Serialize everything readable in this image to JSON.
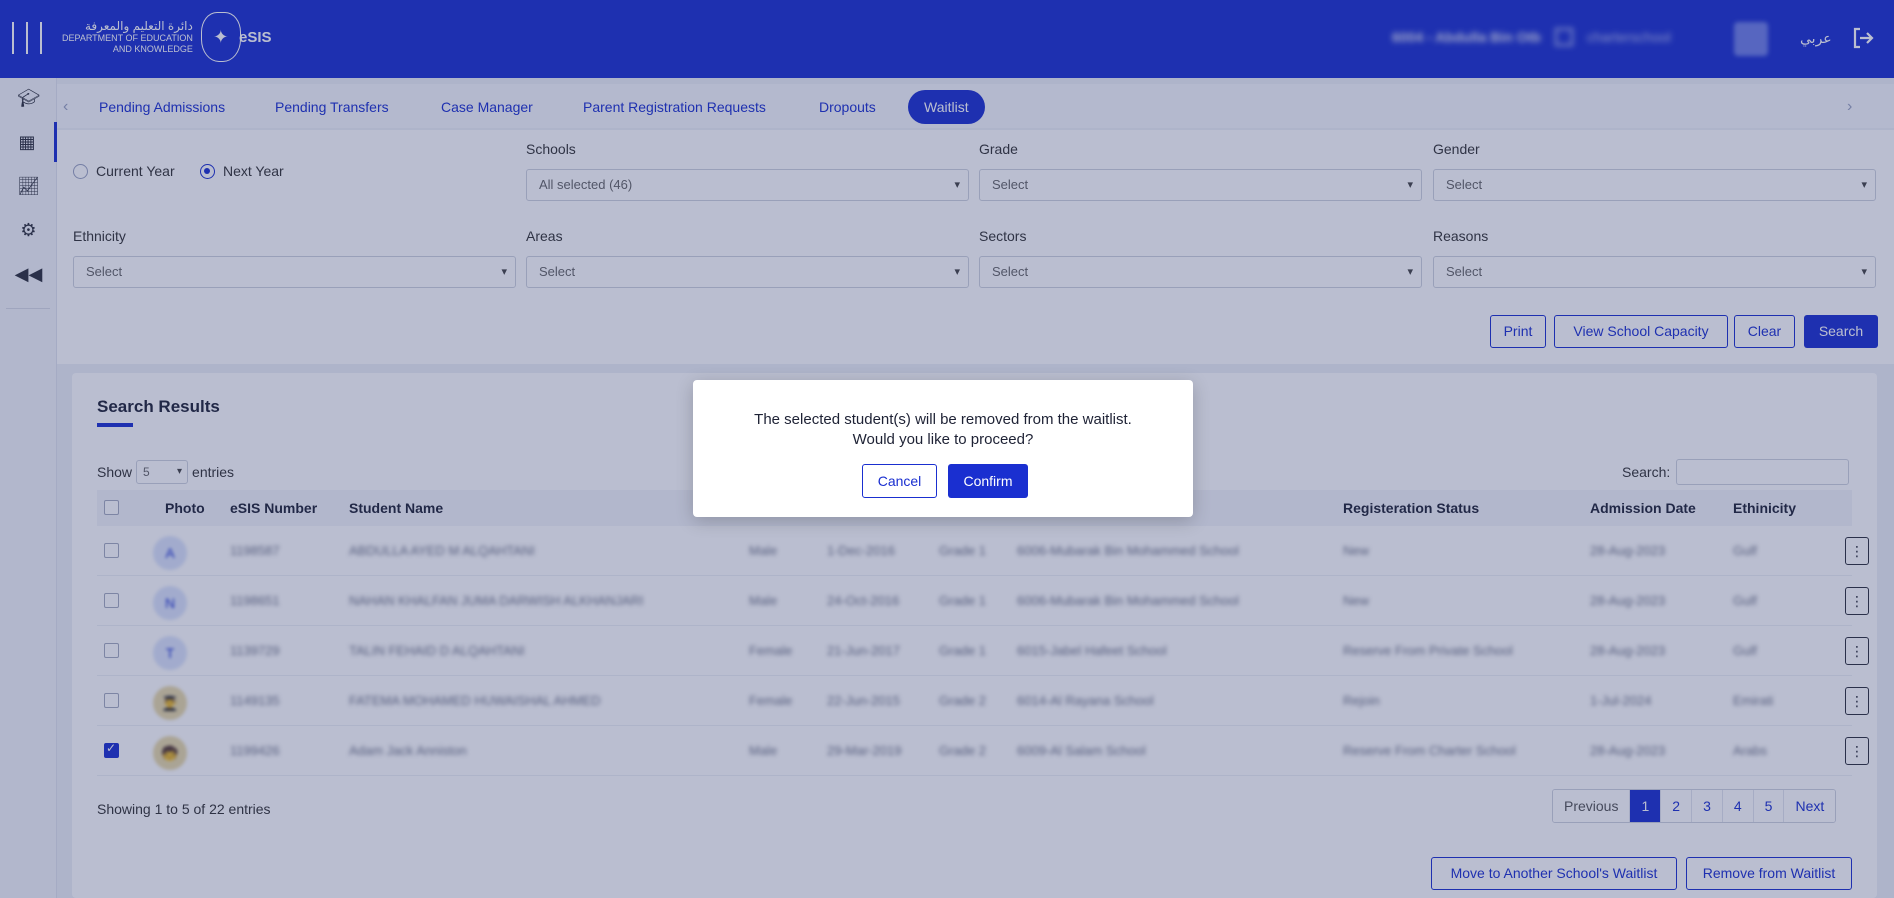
{
  "header": {
    "logo_arabic": "دائرة التعليم والمعرفة",
    "logo_line1": "DEPARTMENT OF EDUCATION",
    "logo_line2": "AND KNOWLEDGE",
    "app_name": "eSIS",
    "user_school": "6004 - Abdulla Bin Otb",
    "user_role": "charterschool",
    "language_toggle": "عربي"
  },
  "sidebar": {
    "items": [
      "graduation-cap-icon",
      "building-icon",
      "chart-line-icon",
      "gear-icon",
      "collapse-icon"
    ]
  },
  "tabs": [
    {
      "label": "Pending Admissions"
    },
    {
      "label": "Pending Transfers"
    },
    {
      "label": "Case Manager"
    },
    {
      "label": "Parent Registration Requests"
    },
    {
      "label": "Dropouts"
    },
    {
      "label": "Waitlist",
      "active": true
    }
  ],
  "filters": {
    "year_current": "Current Year",
    "year_next": "Next Year",
    "selected_year": "Next Year",
    "schools_label": "Schools",
    "schools_value": "All selected (46)",
    "grade_label": "Grade",
    "grade_value": "Select",
    "gender_label": "Gender",
    "gender_value": "Select",
    "ethnicity_label": "Ethnicity",
    "ethnicity_value": "Select",
    "areas_label": "Areas",
    "areas_value": "Select",
    "sectors_label": "Sectors",
    "sectors_value": "Select",
    "reasons_label": "Reasons",
    "reasons_value": "Select"
  },
  "filter_buttons": {
    "print": "Print",
    "view_capacity": "View School Capacity",
    "clear": "Clear",
    "search": "Search"
  },
  "results": {
    "title": "Search Results",
    "show_label": "Show",
    "entries_value": "5",
    "entries_label": "entries",
    "search_label": "Search:",
    "columns": [
      "Photo",
      "eSIS Number",
      "Student Name",
      "Registeration Status",
      "Admission Date",
      "Ethinicity"
    ],
    "rows": [
      {
        "photo": "A",
        "esis": "1198587",
        "name": "ABDULLA AYED M ALQAHTANI",
        "gender": "Male",
        "dob": "1-Dec-2016",
        "grade": "Grade 1",
        "school": "6006-Mubarak Bin Mohammed School",
        "status": "New",
        "admission": "28-Aug-2023",
        "ethnicity": "Gulf",
        "checked": false
      },
      {
        "photo": "N",
        "esis": "1198651",
        "name": "NAHAN KHALFAN JUMA DARWISH ALKHANJARI",
        "gender": "Male",
        "dob": "24-Oct-2016",
        "grade": "Grade 1",
        "school": "6006-Mubarak Bin Mohammed School",
        "status": "New",
        "admission": "28-Aug-2023",
        "ethnicity": "Gulf",
        "checked": false
      },
      {
        "photo": "T",
        "esis": "1139729",
        "name": "TALIN FEHAID D ALQAHTANI",
        "gender": "Female",
        "dob": "21-Jun-2017",
        "grade": "Grade 1",
        "school": "6015-Jabel Hafeet School",
        "status": "Reserve From Private School",
        "admission": "28-Aug-2023",
        "ethnicity": "Gulf",
        "checked": false
      },
      {
        "photo": "👨‍🎓",
        "esis": "1149135",
        "name": "FATEMA MOHAMED HUWAISHAL AHMED",
        "gender": "Female",
        "dob": "22-Jun-2015",
        "grade": "Grade 2",
        "school": "6014-Al Rayana School",
        "status": "Rejoin",
        "admission": "1-Jul-2024",
        "ethnicity": "Emirati",
        "checked": false
      },
      {
        "photo": "🧒",
        "esis": "1199426",
        "name": "Adam Jack Anniston",
        "gender": "Male",
        "dob": "29-Mar-2019",
        "grade": "Grade 2",
        "school": "6009-Al Salam School",
        "status": "Reserve From Charter School",
        "admission": "28-Aug-2023",
        "ethnicity": "Arabs",
        "checked": true
      }
    ],
    "showing": "Showing 1 to 5 of 22 entries",
    "pagination": [
      "Previous",
      "1",
      "2",
      "3",
      "4",
      "5",
      "Next"
    ],
    "current_page": "1",
    "move_button": "Move to Another School's Waitlist",
    "remove_button": "Remove from Waitlist"
  },
  "modal": {
    "line1": "The selected student(s) will be removed from the waitlist.",
    "line2": "Would you like to proceed?",
    "cancel": "Cancel",
    "confirm": "Confirm"
  },
  "colors": {
    "brand": "#1a2fd0",
    "overlay": "#28346e"
  }
}
